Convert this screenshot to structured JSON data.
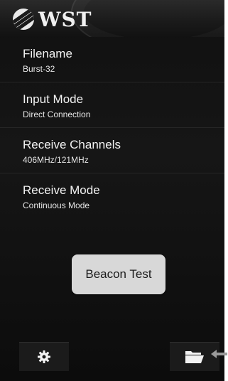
{
  "header": {
    "logo_text": "WST"
  },
  "settings": [
    {
      "title": "Filename",
      "value": "Burst-32"
    },
    {
      "title": "Input Mode",
      "value": "Direct Connection"
    },
    {
      "title": "Receive Channels",
      "value": "406MHz/121MHz"
    },
    {
      "title": "Receive Mode",
      "value": "Continuous Mode"
    }
  ],
  "main": {
    "beacon_test_label": "Beacon Test"
  },
  "toolbar": {
    "settings_icon": "gear-icon",
    "open_icon": "folder-icon"
  },
  "colors": {
    "background": "#121212",
    "text": "#f2f2f2",
    "button": "#d8d8d8"
  }
}
